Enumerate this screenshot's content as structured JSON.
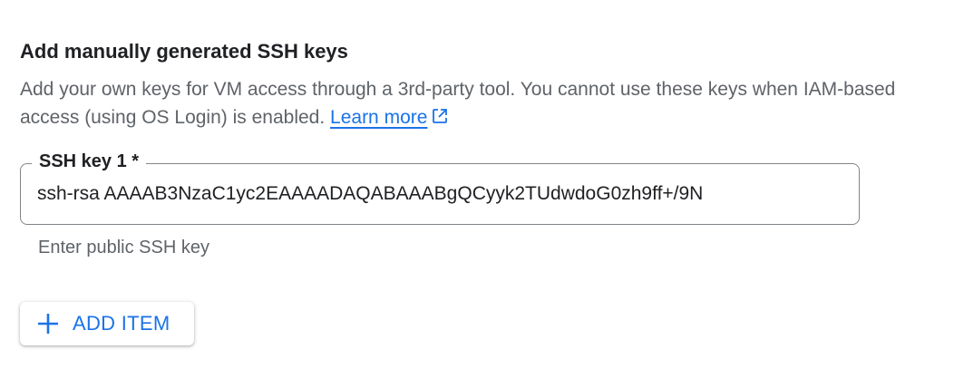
{
  "section": {
    "title": "Add manually generated SSH keys",
    "description": "Add your own keys for VM access through a 3rd-party tool. You cannot use these keys when IAM-based access (using OS Login) is enabled.",
    "learn_more_label": "Learn more",
    "learn_more_icon": "external-link-icon"
  },
  "ssh_key_field": {
    "label": "SSH key 1 *",
    "value": "ssh-rsa AAAAB3NzaC1yc2EAAAADAQABAAABgQCyyk2TUdwdoG0zh9ff+/9N",
    "helper_text": "Enter public SSH key"
  },
  "add_item_button": {
    "label": "ADD ITEM",
    "icon": "plus-icon"
  },
  "colors": {
    "accent": "#1a73e8",
    "text_primary": "#202124",
    "text_secondary": "#5f6368",
    "border": "#80868b"
  }
}
